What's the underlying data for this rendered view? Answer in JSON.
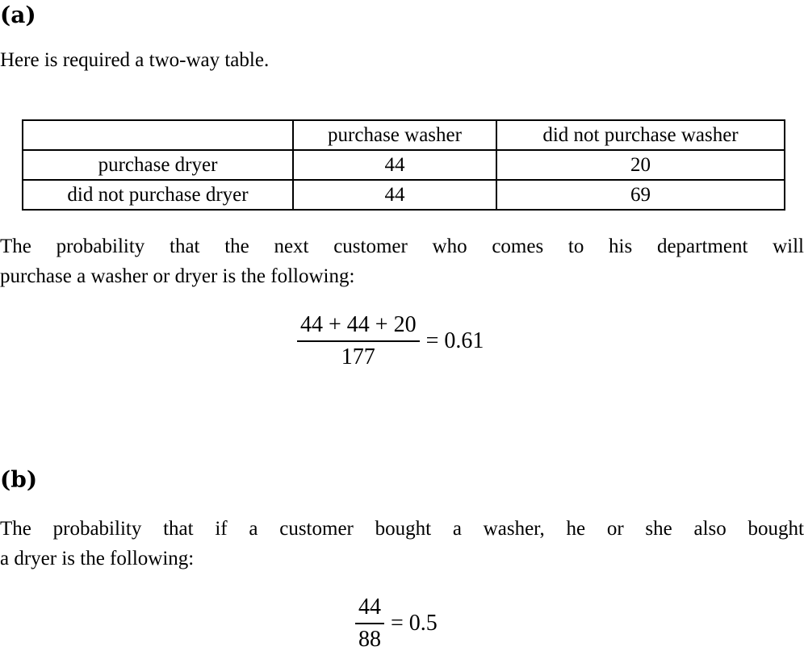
{
  "part_a": {
    "heading": "(a)",
    "intro": "Here is required a two-way table.",
    "table": {
      "header": [
        "",
        "purchase washer",
        "did not purchase washer"
      ],
      "rows": [
        [
          "purchase dryer",
          "44",
          "20"
        ],
        [
          "did not purchase dryer",
          "44",
          "69"
        ]
      ]
    },
    "text_line1": "The probability that the next customer who comes to his department will",
    "text_line2": "purchase a washer or dryer is the following:",
    "equation": {
      "numerator": "44 + 44 + 20",
      "denominator": "177",
      "result": "= 0.61"
    }
  },
  "part_b": {
    "heading": "(b)",
    "text_line1": "The probability that if a customer bought a washer, he or she also bought",
    "text_line2": "a dryer is the following:",
    "equation": {
      "numerator": "44",
      "denominator": "88",
      "result": "= 0.5"
    }
  }
}
